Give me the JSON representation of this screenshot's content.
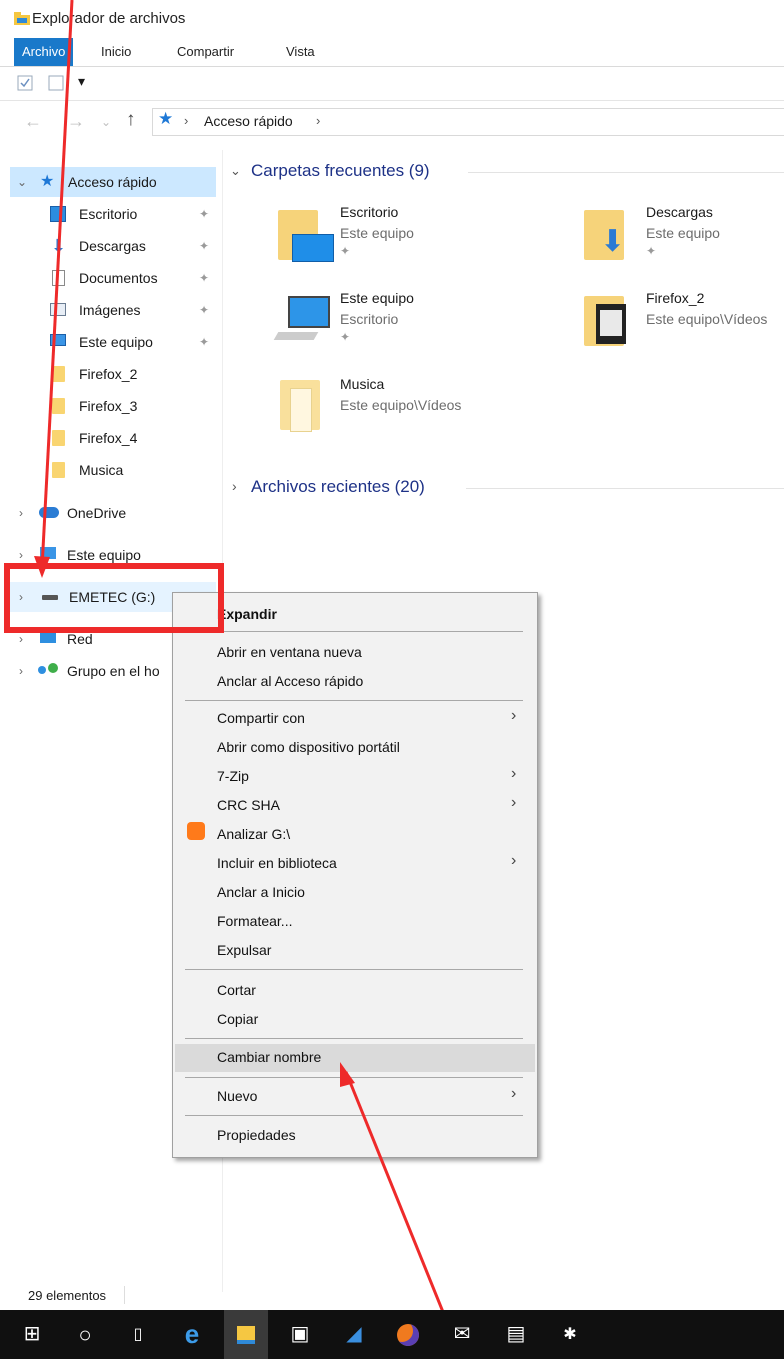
{
  "window": {
    "title": "Explorador de archivos"
  },
  "ribbon": {
    "tabs": [
      "Archivo",
      "Inicio",
      "Compartir",
      "Vista"
    ]
  },
  "address": {
    "path": "Acceso rápido"
  },
  "nav": {
    "quick_access": "Acceso rápido",
    "pinned": [
      "Escritorio",
      "Descargas",
      "Documentos",
      "Imágenes",
      "Este equipo"
    ],
    "folders": [
      "Firefox_2",
      "Firefox_3",
      "Firefox_4",
      "Musica"
    ],
    "onedrive": "OneDrive",
    "this_pc": "Este equipo",
    "drive": "EMETEC (G:)",
    "network": "Red",
    "homegroup": "Grupo en el ho"
  },
  "content": {
    "frequent_header": "Carpetas frecuentes (9)",
    "recent_header": "Archivos recientes (20)",
    "tiles": [
      {
        "name": "Escritorio",
        "sub": "Este equipo"
      },
      {
        "name": "Descargas",
        "sub": "Este equipo"
      },
      {
        "name": "Este equipo",
        "sub": "Escritorio"
      },
      {
        "name": "Firefox_2",
        "sub": "Este equipo\\Vídeos"
      },
      {
        "name": "Musica",
        "sub": "Este equipo\\Vídeos"
      }
    ]
  },
  "context_menu": {
    "items": [
      "Expandir",
      "Abrir en ventana nueva",
      "Anclar al Acceso rápido",
      "Compartir con",
      "Abrir como dispositivo portátil",
      "7-Zip",
      "CRC SHA",
      "Analizar G:\\",
      "Incluir en biblioteca",
      "Anclar a Inicio",
      "Formatear...",
      "Expulsar",
      "Cortar",
      "Copiar",
      "Cambiar nombre",
      "Nuevo",
      "Propiedades"
    ],
    "highlighted": "Cambiar nombre"
  },
  "status": {
    "count": "29 elementos"
  },
  "colors": {
    "accent": "#1979ca",
    "selection": "#cce8ff",
    "annotation": "#ee2a2a",
    "taskbar": "#101010"
  }
}
